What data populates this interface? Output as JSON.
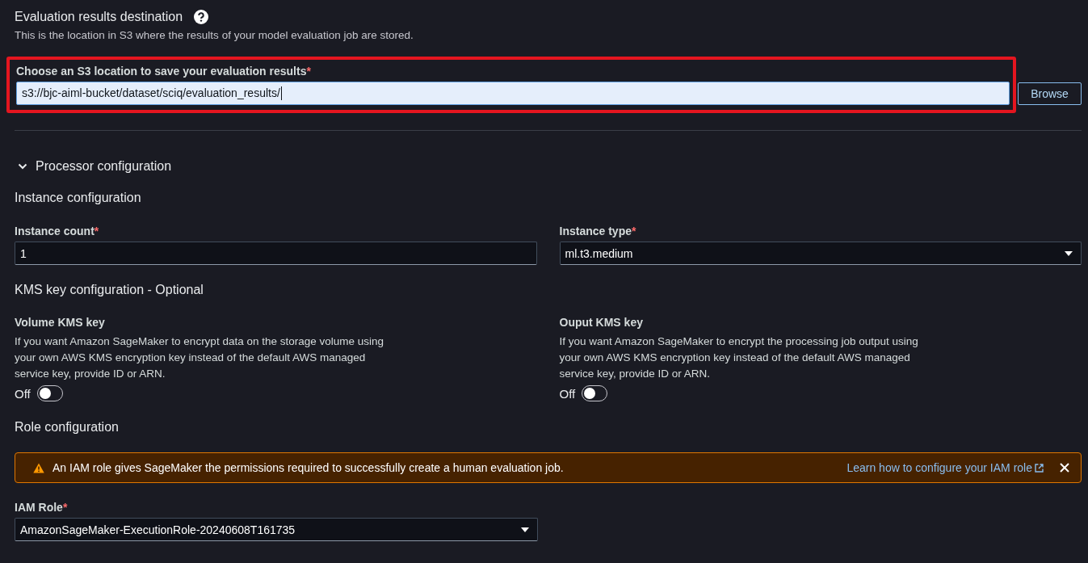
{
  "destination": {
    "title": "Evaluation results destination",
    "description": "This is the location in S3 where the results of your model evaluation job are stored.",
    "field": {
      "label": "Choose an S3 location to save your evaluation results",
      "required_mark": "*",
      "value": "s3://bjc-aiml-bucket/dataset/sciq/evaluation_results/",
      "focused": true,
      "highlighted": true
    },
    "browse_button": "Browse"
  },
  "processor": {
    "title": "Processor configuration",
    "expanded": true,
    "instance": {
      "heading": "Instance configuration",
      "fields": [
        {
          "kind": "input",
          "label": "Instance count",
          "required_mark": "*",
          "value": "1"
        },
        {
          "kind": "select",
          "label": "Instance type",
          "required_mark": "*",
          "value": "ml.t3.medium"
        }
      ]
    },
    "kms": {
      "heading": "KMS key configuration - Optional",
      "keys": [
        {
          "label": "Volume KMS key",
          "description": "If you want Amazon SageMaker to encrypt data on the storage volume using your own AWS KMS encryption key instead of the default AWS managed service key, provide ID or ARN.",
          "toggle_label": "Off",
          "on": false
        },
        {
          "label": "Ouput KMS key",
          "description": "If you want Amazon SageMaker to encrypt the processing job output using your own AWS KMS encryption key instead of the default AWS managed service key, provide ID or ARN.",
          "toggle_label": "Off",
          "on": false
        }
      ]
    },
    "role": {
      "heading": "Role configuration",
      "alert": {
        "kind": "warning",
        "text": "An IAM role gives SageMaker the permissions required to successfully create a human evaluation job.",
        "link": "Learn how to configure your IAM role",
        "dismissible": true
      },
      "field": {
        "kind": "select",
        "label": "IAM Role",
        "required_mark": "*",
        "value": "AmazonSageMaker-ExecutionRole-20240608T161735"
      }
    }
  }
}
